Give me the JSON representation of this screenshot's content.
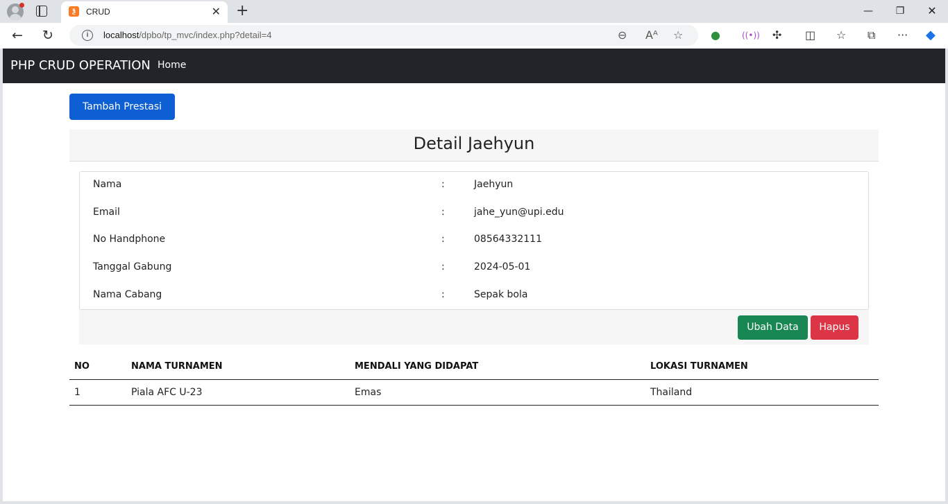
{
  "browser": {
    "tab_title": "CRUD",
    "url_host": "localhost",
    "url_path": "/dpbo/tp_mvc/index.php?detail=4"
  },
  "navbar": {
    "brand": "PHP CRUD OPERATION",
    "home": "Home"
  },
  "actions": {
    "add_label": "Tambah Prestasi",
    "edit_label": "Ubah Data",
    "delete_label": "Hapus"
  },
  "detail": {
    "title": "Detail Jaehyun",
    "separator": ":",
    "fields": [
      {
        "label": "Nama",
        "value": "Jaehyun"
      },
      {
        "label": "Email",
        "value": "jahe_yun@upi.edu"
      },
      {
        "label": "No Handphone",
        "value": "08564332111"
      },
      {
        "label": "Tanggal Gabung",
        "value": "2024-05-01"
      },
      {
        "label": "Nama Cabang",
        "value": "Sepak bola"
      }
    ]
  },
  "table": {
    "headers": [
      "NO",
      "NAMA TURNAMEN",
      "MENDALI YANG DIDAPAT",
      "LOKASI TURNAMEN"
    ],
    "rows": [
      [
        "1",
        "Piala AFC U-23",
        "Emas",
        "Thailand"
      ]
    ]
  },
  "colors": {
    "navbar_bg": "#212529",
    "primary": "#0d5fd3",
    "success": "#198754",
    "danger": "#dc3545"
  }
}
